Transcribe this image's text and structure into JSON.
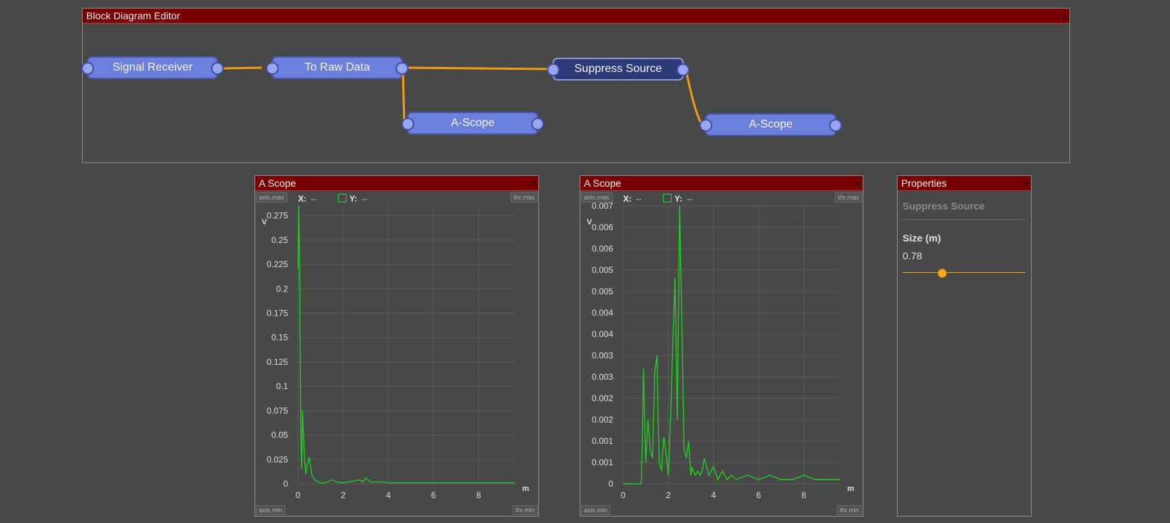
{
  "editor": {
    "title": "Block Diagram Editor",
    "close": "×",
    "nodes": [
      {
        "id": "signal-receiver",
        "label": "Signal Receiver"
      },
      {
        "id": "to-raw-data",
        "label": "To Raw Data"
      },
      {
        "id": "a-scope-1",
        "label": "A-Scope"
      },
      {
        "id": "suppress-source",
        "label": "Suppress Source",
        "selected": true
      },
      {
        "id": "a-scope-2",
        "label": "A-Scope"
      }
    ],
    "wire_color": "#f39c12"
  },
  "scopes": [
    {
      "title": "A Scope",
      "close": "×",
      "axis_max": "axis.max",
      "axis_min": "axis.min",
      "thr_max": "thr.max",
      "thr_min": "thr.min",
      "x_label": "X:",
      "x_value": "--",
      "y_label": "Y:",
      "y_value": "--"
    },
    {
      "title": "A Scope",
      "close": "×",
      "axis_max": "axis.max",
      "axis_min": "axis.min",
      "thr_max": "thr.max",
      "thr_min": "thr.min",
      "x_label": "X:",
      "x_value": "--",
      "y_label": "Y:",
      "y_value": "--"
    }
  ],
  "properties": {
    "title": "Properties",
    "close": "×",
    "subtitle": "Suppress Source",
    "field_label": "Size (m)",
    "field_value": "0.78",
    "slider_fraction": 0.32
  },
  "chart_data": [
    {
      "type": "line",
      "xlabel": "m",
      "ylabel": "V",
      "xlim": [
        0,
        9.6
      ],
      "ylim": [
        0,
        0.285
      ],
      "xticks": [
        "0",
        "2",
        "4",
        "6",
        "8"
      ],
      "xtick_values": [
        0,
        2,
        4,
        6,
        8
      ],
      "yticks": [
        "0",
        "0.025",
        "0.05",
        "0.075",
        "0.1",
        "0.125",
        "0.15",
        "0.175",
        "0.2",
        "0.225",
        "0.25",
        "0.275"
      ],
      "ytick_values": [
        0,
        0.025,
        0.05,
        0.075,
        0.1,
        0.125,
        0.15,
        0.175,
        0.2,
        0.225,
        0.25,
        0.275
      ],
      "grid": true,
      "color": "#22cc22",
      "series": [
        {
          "x": [
            0,
            0.03,
            0.08,
            0.12,
            0.16,
            0.2,
            0.25,
            0.3,
            0.35,
            0.4,
            0.5,
            0.6,
            0.7,
            0.8,
            1.0,
            1.2,
            1.5,
            1.7,
            2.0,
            2.2,
            2.5,
            2.7,
            2.9,
            3.0,
            3.1,
            3.2,
            3.5,
            3.8,
            4.0,
            4.5,
            5.0,
            5.5,
            6.0,
            6.5,
            7.0,
            7.5,
            8.0,
            8.5,
            9.0,
            9.6
          ],
          "y": [
            0.22,
            0.285,
            0.2,
            0.06,
            0.015,
            0.075,
            0.045,
            0.02,
            0.01,
            0.02,
            0.027,
            0.01,
            0.005,
            0.003,
            0.001,
            0.001,
            0.004,
            0.002,
            0.001,
            0.002,
            0.003,
            0.004,
            0.002,
            0.006,
            0.004,
            0.002,
            0.002,
            0.002,
            0.001,
            0.001,
            0.001,
            0.001,
            0.001,
            0.001,
            0.001,
            0.001,
            0.001,
            0.001,
            0.001,
            0.001
          ]
        }
      ]
    },
    {
      "type": "line",
      "xlabel": "m",
      "ylabel": "V",
      "xlim": [
        0,
        9.6
      ],
      "ylim": [
        0,
        0.0065
      ],
      "xticks": [
        "0",
        "2",
        "4",
        "6",
        "8"
      ],
      "xtick_values": [
        0,
        2,
        4,
        6,
        8
      ],
      "yticks": [
        "0",
        "0.001",
        "0.001",
        "0.002",
        "0.002",
        "0.003",
        "0.003",
        "0.004",
        "0.004",
        "0.005",
        "0.005",
        "0.006",
        "0.006",
        "0.007"
      ],
      "ytick_values": [
        0,
        0.0005,
        0.001,
        0.0015,
        0.002,
        0.0025,
        0.003,
        0.0035,
        0.004,
        0.0045,
        0.005,
        0.0055,
        0.006,
        0.0065
      ],
      "grid": true,
      "color": "#22cc22",
      "series": [
        {
          "x": [
            0,
            0.5,
            0.8,
            0.85,
            0.9,
            1.0,
            1.1,
            1.2,
            1.3,
            1.4,
            1.5,
            1.55,
            1.6,
            1.7,
            1.8,
            1.9,
            2.0,
            2.1,
            2.2,
            2.3,
            2.4,
            2.5,
            2.6,
            2.7,
            2.8,
            2.9,
            3.0,
            3.05,
            3.1,
            3.2,
            3.3,
            3.4,
            3.5,
            3.6,
            3.8,
            4.0,
            4.2,
            4.4,
            4.6,
            4.8,
            5.0,
            5.5,
            6.0,
            6.5,
            7.0,
            7.5,
            8.0,
            8.5,
            9.0,
            9.6
          ],
          "y": [
            0,
            0,
            0,
            0.0009,
            0.0027,
            0.0005,
            0.0015,
            0.0008,
            0.0006,
            0.0026,
            0.003,
            0.0015,
            0.0005,
            0.0003,
            0.0011,
            0.0007,
            0.0002,
            0.0015,
            0.0033,
            0.0048,
            0.0015,
            0.0065,
            0.0038,
            0.0008,
            0.0006,
            0.001,
            0.0002,
            0.0004,
            0.0003,
            0.0002,
            0.0003,
            0.0002,
            0.0003,
            0.0006,
            0.0002,
            0.0004,
            0.0001,
            0.0003,
            0.0001,
            0.0002,
            0.0001,
            0.0002,
            0.0001,
            0.0002,
            0.0001,
            0.0001,
            0.0002,
            0.0001,
            0.0001,
            0.0001
          ]
        }
      ]
    }
  ]
}
